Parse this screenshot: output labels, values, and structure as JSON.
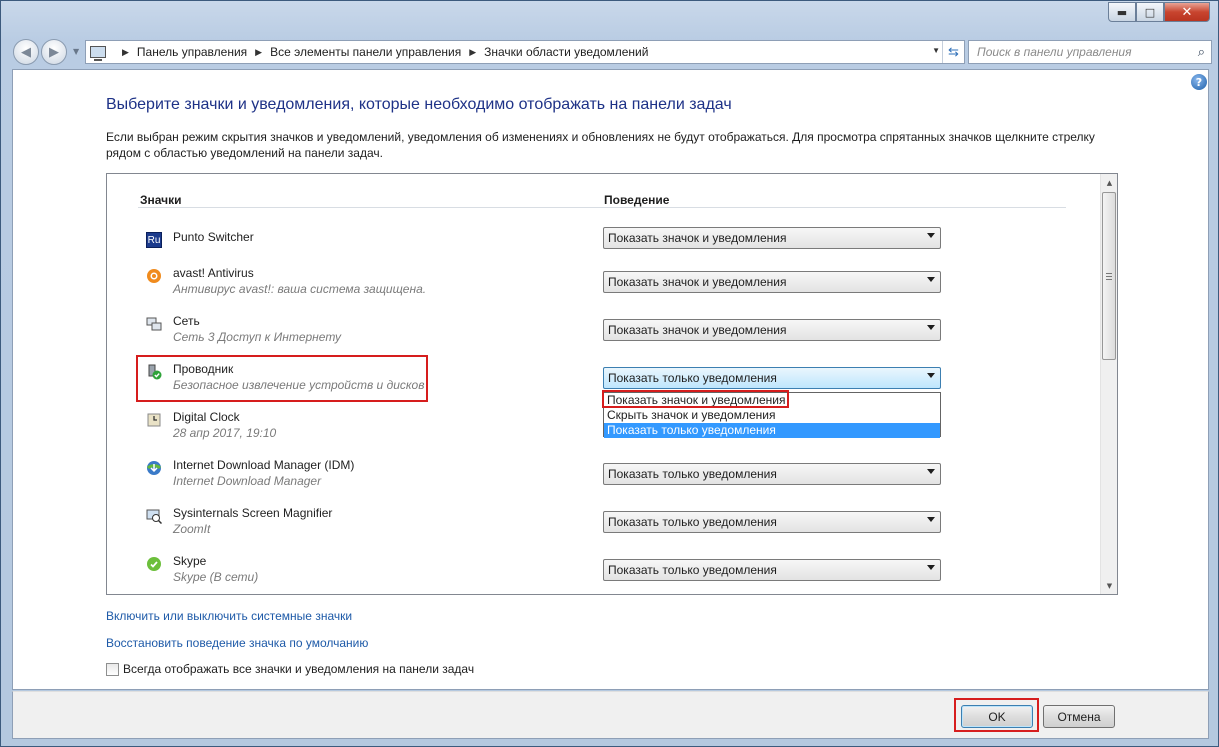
{
  "window": {
    "caption": {
      "minimize": "▬",
      "maximize": "□",
      "close": "✕"
    }
  },
  "nav": {
    "back_glyph": "◀",
    "forward_glyph": "▶",
    "breadcrumb": [
      "Панель управления",
      "Все элементы панели управления",
      "Значки области уведомлений"
    ],
    "search_placeholder": "Поиск в панели управления"
  },
  "page": {
    "title": "Выберите значки и уведомления, которые необходимо отображать на панели задач",
    "description": "Если выбран режим скрытия значков и уведомлений, уведомления об изменениях и обновлениях не будут отображаться. Для просмотра спрятанных значков щелкните стрелку рядом с областью уведомлений на панели задач."
  },
  "table": {
    "col_icons": "Значки",
    "col_behavior": "Поведение",
    "rows": [
      {
        "name": "Punto Switcher",
        "subtitle": "",
        "behavior": "Показать значок и уведомления",
        "icon": "punto-switcher-icon",
        "badge": "Ru"
      },
      {
        "name": "avast! Antivirus",
        "subtitle": "Антивирус avast!: ваша система защищена.",
        "behavior": "Показать значок и уведомления",
        "icon": "avast-icon"
      },
      {
        "name": "Сеть",
        "subtitle": "Сеть  3 Доступ к Интернету",
        "behavior": "Показать значок и уведомления",
        "icon": "network-icon"
      },
      {
        "name": "Проводник",
        "subtitle": "Безопасное извлечение устройств и дисков",
        "behavior": "Показать только уведомления",
        "icon": "safely-remove-icon"
      },
      {
        "name": "Digital Clock",
        "subtitle": "28 апр 2017, 19:10",
        "behavior": "",
        "icon": "clock-icon"
      },
      {
        "name": "Internet Download Manager (IDM)",
        "subtitle": "Internet Download Manager",
        "behavior": "Показать только уведомления",
        "icon": "idm-icon"
      },
      {
        "name": "Sysinternals Screen Magnifier",
        "subtitle": "ZoomIt",
        "behavior": "Показать только уведомления",
        "icon": "zoomit-icon"
      },
      {
        "name": "Skype",
        "subtitle": "Skype (В сети)",
        "behavior": "Показать только уведомления",
        "icon": "skype-icon"
      }
    ],
    "dropdown_options": [
      "Показать значок и уведомления",
      "Скрыть значок и уведомления",
      "Показать только уведомления"
    ],
    "dropdown_selected": "Показать только уведомления"
  },
  "links": {
    "system_icons": "Включить или выключить системные значки",
    "restore_defaults": "Восстановить поведение значка по умолчанию"
  },
  "checkbox": {
    "label": "Всегда отображать все значки и уведомления на панели задач",
    "checked": false
  },
  "buttons": {
    "ok": "OK",
    "cancel": "Отмена"
  },
  "colors": {
    "highlight": "#d61d1d",
    "link": "#1e5aa8",
    "title": "#1e3287",
    "selection": "#3399ff"
  }
}
